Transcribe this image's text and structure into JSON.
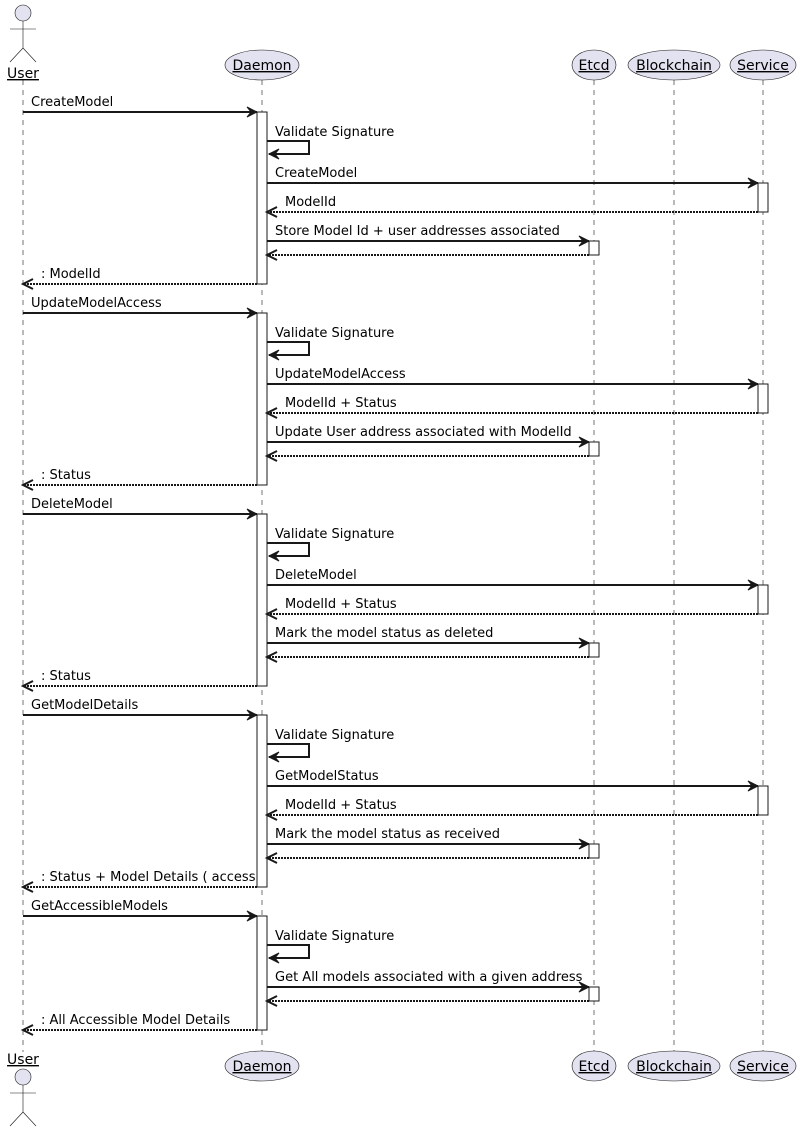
{
  "colors": {
    "participant_fill": "#E2E2F0",
    "participant_stroke": "#181818",
    "line": "#181818",
    "lifeline": "#181818"
  },
  "participants": [
    {
      "id": "user",
      "name": "User",
      "kind": "actor"
    },
    {
      "id": "daemon",
      "name": "Daemon",
      "kind": "entity"
    },
    {
      "id": "etcd",
      "name": "Etcd",
      "kind": "entity"
    },
    {
      "id": "blockchain",
      "name": "Blockchain",
      "kind": "entity"
    },
    {
      "id": "service",
      "name": "Service",
      "kind": "entity"
    }
  ],
  "messages": [
    {
      "from": "user",
      "to": "daemon",
      "type": "sync",
      "label": "CreateModel"
    },
    {
      "from": "daemon",
      "to": "daemon",
      "type": "self",
      "label": "Validate Signature"
    },
    {
      "from": "daemon",
      "to": "service",
      "type": "sync",
      "label": "CreateModel"
    },
    {
      "from": "service",
      "to": "daemon",
      "type": "return",
      "label": "ModelId"
    },
    {
      "from": "daemon",
      "to": "etcd",
      "type": "sync",
      "label": "Store Model Id + user addresses associated"
    },
    {
      "from": "etcd",
      "to": "daemon",
      "type": "return",
      "label": ""
    },
    {
      "from": "daemon",
      "to": "user",
      "type": "return",
      "label": ": ModelId"
    },
    {
      "from": "user",
      "to": "daemon",
      "type": "sync",
      "label": "UpdateModelAccess"
    },
    {
      "from": "daemon",
      "to": "daemon",
      "type": "self",
      "label": "Validate Signature"
    },
    {
      "from": "daemon",
      "to": "service",
      "type": "sync",
      "label": "UpdateModelAccess"
    },
    {
      "from": "service",
      "to": "daemon",
      "type": "return",
      "label": "ModelId + Status"
    },
    {
      "from": "daemon",
      "to": "etcd",
      "type": "sync",
      "label": "Update User address associated with ModelId"
    },
    {
      "from": "etcd",
      "to": "daemon",
      "type": "return",
      "label": ""
    },
    {
      "from": "daemon",
      "to": "user",
      "type": "return",
      "label": ": Status"
    },
    {
      "from": "user",
      "to": "daemon",
      "type": "sync",
      "label": "DeleteModel"
    },
    {
      "from": "daemon",
      "to": "daemon",
      "type": "self",
      "label": "Validate Signature"
    },
    {
      "from": "daemon",
      "to": "service",
      "type": "sync",
      "label": "DeleteModel"
    },
    {
      "from": "service",
      "to": "daemon",
      "type": "return",
      "label": "ModelId + Status"
    },
    {
      "from": "daemon",
      "to": "etcd",
      "type": "sync",
      "label": "Mark the model status as deleted"
    },
    {
      "from": "etcd",
      "to": "daemon",
      "type": "return",
      "label": ""
    },
    {
      "from": "daemon",
      "to": "user",
      "type": "return",
      "label": ": Status"
    },
    {
      "from": "user",
      "to": "daemon",
      "type": "sync",
      "label": "GetModelDetails"
    },
    {
      "from": "daemon",
      "to": "daemon",
      "type": "self",
      "label": "Validate Signature"
    },
    {
      "from": "daemon",
      "to": "service",
      "type": "sync",
      "label": "GetModelStatus"
    },
    {
      "from": "service",
      "to": "daemon",
      "type": "return",
      "label": "ModelId + Status"
    },
    {
      "from": "daemon",
      "to": "etcd",
      "type": "sync",
      "label": "Mark the model status as received"
    },
    {
      "from": "etcd",
      "to": "daemon",
      "type": "return",
      "label": ""
    },
    {
      "from": "daemon",
      "to": "user",
      "type": "return",
      "label": ": Status + Model Details ( access"
    },
    {
      "from": "user",
      "to": "daemon",
      "type": "sync",
      "label": "GetAccessibleModels"
    },
    {
      "from": "daemon",
      "to": "daemon",
      "type": "self",
      "label": "Validate Signature"
    },
    {
      "from": "daemon",
      "to": "etcd",
      "type": "sync",
      "label": "Get All models associated with a given address"
    },
    {
      "from": "etcd",
      "to": "daemon",
      "type": "return",
      "label": ""
    },
    {
      "from": "daemon",
      "to": "user",
      "type": "return",
      "label": ": All Accessible Model Details"
    }
  ]
}
